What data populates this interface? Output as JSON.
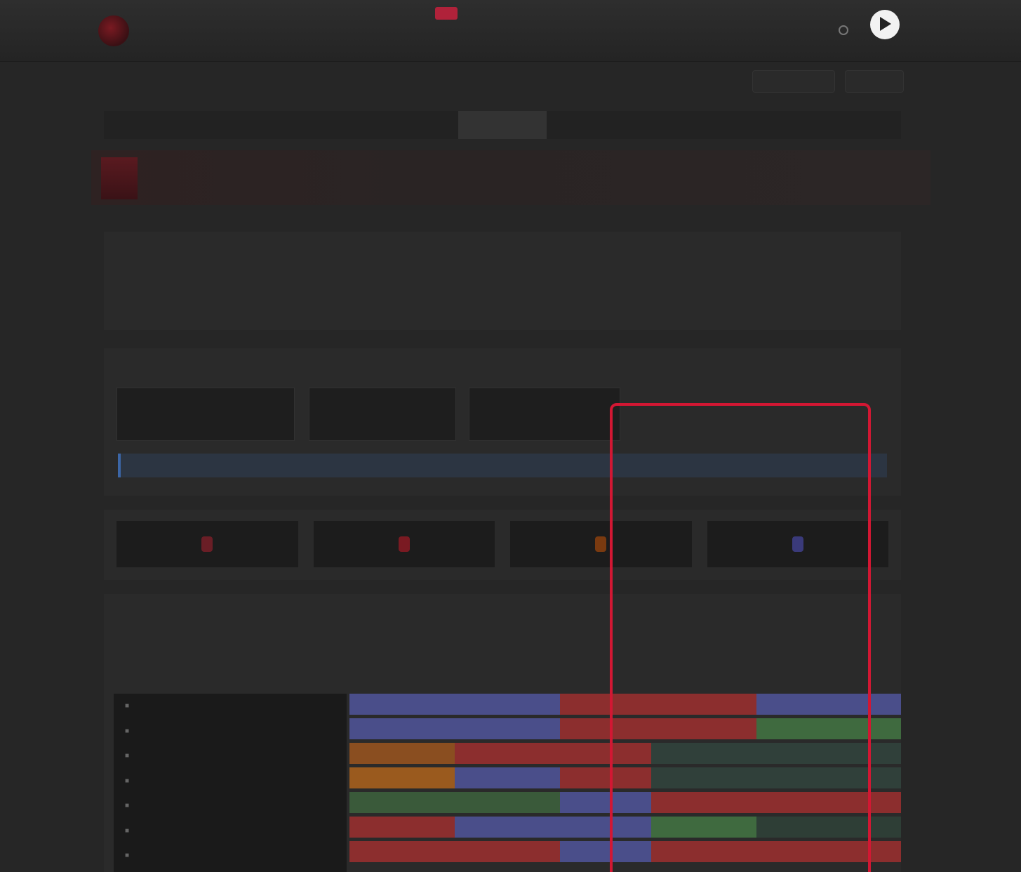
{
  "header": {
    "logo_text": "",
    "nav": [
      "",
      "",
      "",
      "",
      "",
      ""
    ],
    "nav_badge": "",
    "user_name": ""
  },
  "subheader": {
    "breadcrumb": "",
    "btn1": "",
    "btn2": ""
  },
  "tabs": [
    "",
    "",
    "",
    "",
    "",
    "",
    "",
    "",
    ""
  ],
  "hero": {
    "title": "",
    "subtitle": ""
  },
  "intro": {
    "line1_bold": "",
    "line1": "",
    "line2": "",
    "line3": "",
    "line4": ""
  },
  "panel": {
    "title": "",
    "sel1_label": "",
    "sel1_value": "",
    "sel2_label": "",
    "sel2_value": "",
    "sel3_label": "",
    "sel3_value": "",
    "info": ""
  },
  "stats": [
    "",
    "",
    "",
    ""
  ],
  "matrix": {
    "title": "",
    "desc": "",
    "legend": "",
    "search_head": "",
    "columns": [
      "",
      "",
      "",
      "",
      ""
    ],
    "rows": [
      "",
      "",
      "",
      "",
      "",
      "",
      ""
    ]
  },
  "colors": {
    "accent": "#d21733",
    "blue_cell": "#4a4e8a",
    "red_cell": "#8c2e2e",
    "green_cell": "#3f6a3f",
    "orange_cell": "#9a5a1e"
  }
}
